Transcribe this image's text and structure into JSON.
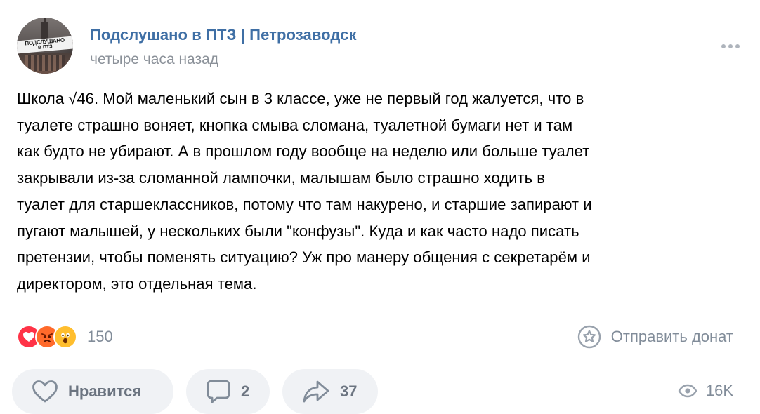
{
  "post": {
    "group_name": "Подслушано в ПТЗ | Петрозаводск",
    "time": "четыре часа назад",
    "avatar_text": [
      "ПОДСЛУШАНО",
      "В ПТЗ"
    ],
    "text_lines": [
      "Школа √46. Мой маленький сын в 3 классе, уже не первый год жалуется, что в",
      "туалете страшно воняет, кнопка смыва сломана, туалетной бумаги нет и там",
      "как будто не убирают. А в прошлом году вообще на неделю или больше туалет",
      "закрывали из-за сломанной лампочки, малышам было страшно ходить в",
      "туалет для старшеклассников, потому что там накурено, и старшие запирают и",
      "пугают малышей, у нескольких были \"конфузы\". Куда и как часто надо писать",
      "претензии, чтобы поменять ситуацию? Уж про манеру общения с секретарём и",
      "директором, это отдельная тема."
    ]
  },
  "reactions": {
    "icons": [
      "heart-reaction",
      "angry-reaction",
      "wow-reaction"
    ],
    "count": "150"
  },
  "donate": {
    "label": "Отправить донат"
  },
  "actions": {
    "like_label": "Нравится",
    "comments_count": "2",
    "shares_count": "37"
  },
  "views": {
    "count": "16K"
  },
  "colors": {
    "link": "#3f6fa5",
    "muted": "#818c99",
    "button_bg": "#f0f2f5",
    "heart": "#ff3347",
    "angry": "#ff6a2b",
    "wow": "#ffbe2e"
  }
}
